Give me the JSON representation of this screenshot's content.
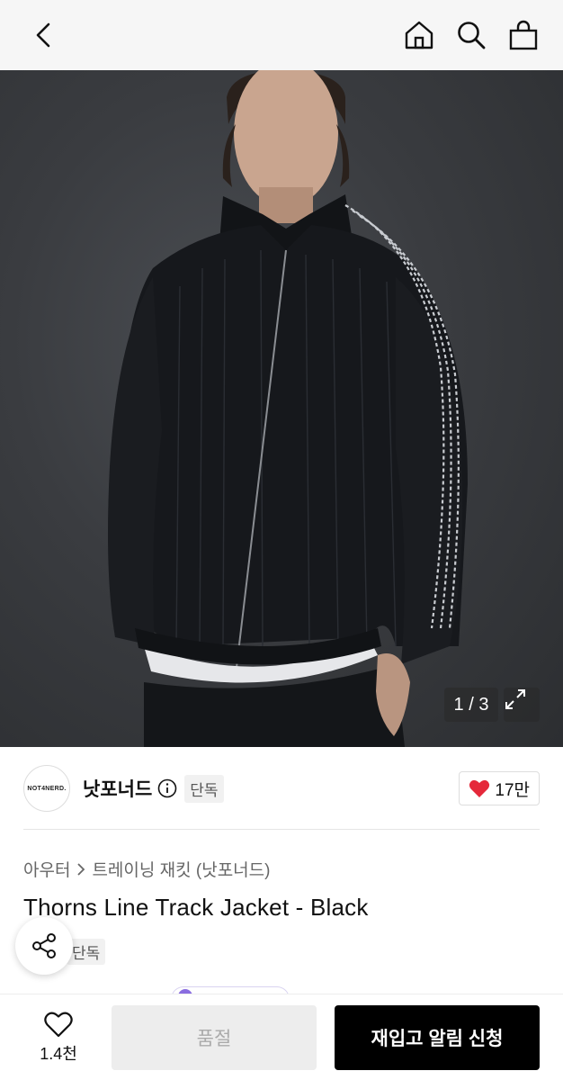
{
  "header": {
    "back_icon": "chevron-left-icon",
    "icons": [
      "home-icon",
      "search-icon",
      "shopping-bag-icon"
    ]
  },
  "gallery": {
    "counter": "1 / 3",
    "expand_icon": "expand-icon"
  },
  "brand": {
    "logo_text": "NOT4NERD.",
    "name": "낫포너드",
    "tag": "단독",
    "likes": "17만",
    "like_color": "#e5283a"
  },
  "product": {
    "breadcrumb": [
      "아우터",
      "트레이닝 재킷 (낫포너드)"
    ],
    "title": "Thorns Line Track Jacket - Black",
    "tag": "단독"
  },
  "bottom": {
    "wish_count": "1.4천",
    "soldout_label": "품절",
    "restock_label": "재입고 알림 신청"
  }
}
